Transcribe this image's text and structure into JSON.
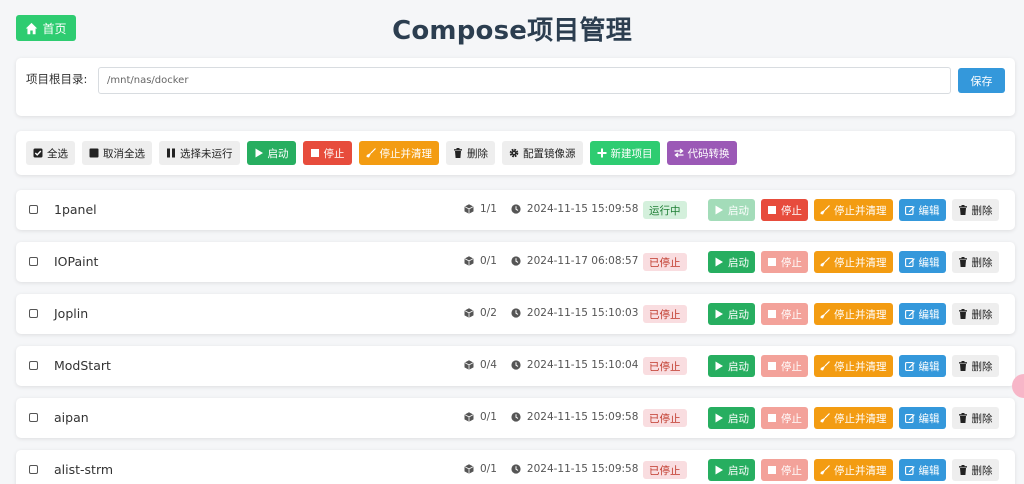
{
  "header": {
    "home_label": "首页",
    "title": "Compose项目管理"
  },
  "path": {
    "label": "项目根目录:",
    "value": "/mnt/nas/docker",
    "save_label": "保存"
  },
  "toolbar": {
    "select_all": "全选",
    "deselect_all": "取消全选",
    "select_stopped": "选择未运行",
    "start": "启动",
    "stop": "停止",
    "stop_clean": "停止并清理",
    "delete": "删除",
    "mirror": "配置镜像源",
    "new_project": "新建项目",
    "convert": "代码转换"
  },
  "row_actions": {
    "start": "启动",
    "stop": "停止",
    "stop_clean": "停止并清理",
    "edit": "编辑",
    "delete": "删除"
  },
  "projects": [
    {
      "name": "1panel",
      "containers": "1/1",
      "time": "2024-11-15 15:09:58",
      "status": "运行中",
      "running": true
    },
    {
      "name": "IOPaint",
      "containers": "0/1",
      "time": "2024-11-17 06:08:57",
      "status": "已停止",
      "running": false
    },
    {
      "name": "Joplin",
      "containers": "0/2",
      "time": "2024-11-15 15:10:03",
      "status": "已停止",
      "running": false
    },
    {
      "name": "ModStart",
      "containers": "0/4",
      "time": "2024-11-15 15:10:04",
      "status": "已停止",
      "running": false
    },
    {
      "name": "aipan",
      "containers": "0/1",
      "time": "2024-11-15 15:09:58",
      "status": "已停止",
      "running": false
    },
    {
      "name": "alist-strm",
      "containers": "0/1",
      "time": "2024-11-15 15:09:58",
      "status": "已停止",
      "running": false
    }
  ],
  "colors": {
    "green": "#27ae60",
    "red": "#e74c3c",
    "orange": "#f39c12",
    "blue": "#3498db",
    "purple": "#9b59b6",
    "title": "#2c3e50"
  }
}
